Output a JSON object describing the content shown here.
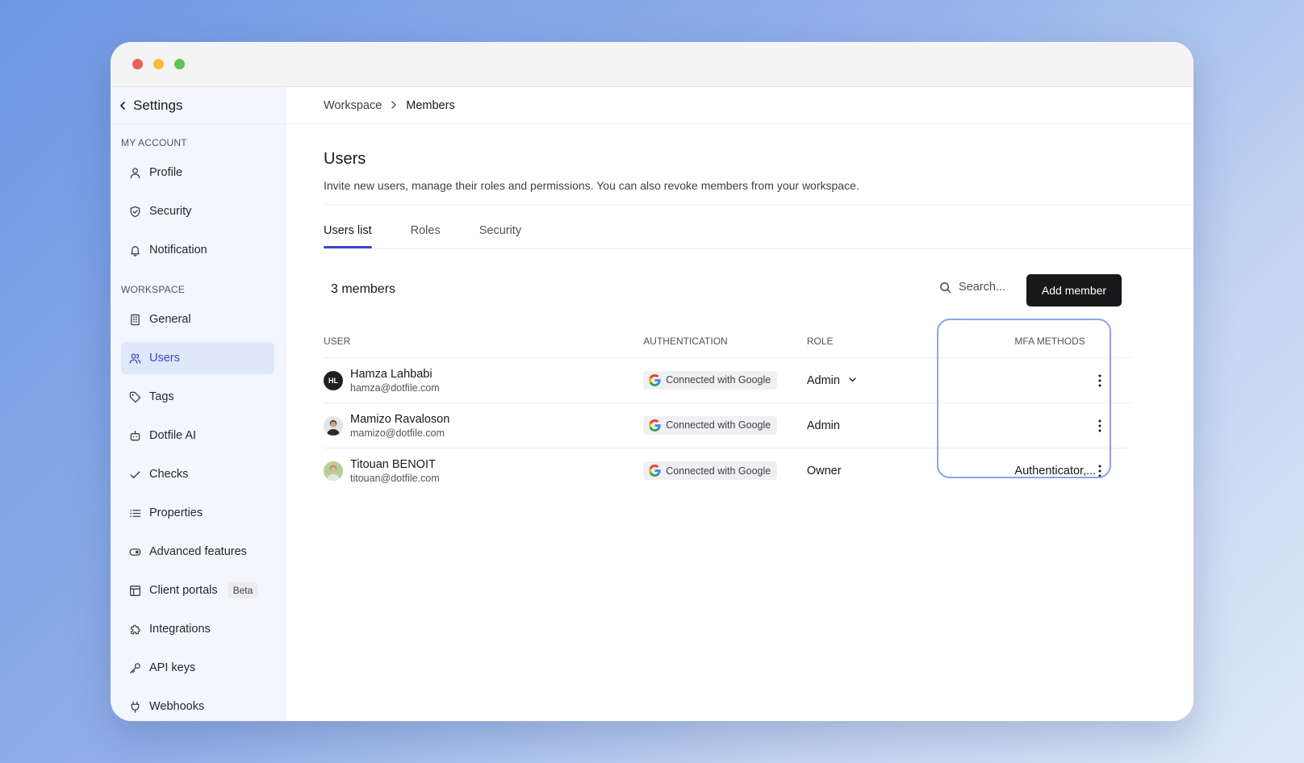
{
  "sidebar": {
    "title": "Settings",
    "sections": [
      {
        "heading": "My account",
        "items": [
          {
            "label": "Profile",
            "icon": "user-icon"
          },
          {
            "label": "Security",
            "icon": "shield-icon"
          },
          {
            "label": "Notification",
            "icon": "bell-icon"
          }
        ]
      },
      {
        "heading": "Workspace",
        "items": [
          {
            "label": "General",
            "icon": "building-icon"
          },
          {
            "label": "Users",
            "icon": "users-icon",
            "active": true
          },
          {
            "label": "Tags",
            "icon": "tag-icon"
          },
          {
            "label": "Dotfile AI",
            "icon": "robot-icon"
          },
          {
            "label": "Checks",
            "icon": "check-icon"
          },
          {
            "label": "Properties",
            "icon": "list-icon"
          },
          {
            "label": "Advanced features",
            "icon": "toggle-icon"
          },
          {
            "label": "Client portals",
            "icon": "layout-icon",
            "badge": "Beta"
          },
          {
            "label": "Integrations",
            "icon": "puzzle-icon"
          },
          {
            "label": "API keys",
            "icon": "key-icon"
          },
          {
            "label": "Webhooks",
            "icon": "webhook-icon"
          }
        ]
      }
    ]
  },
  "breadcrumb": {
    "parent": "Workspace",
    "current": "Members"
  },
  "page": {
    "title": "Users",
    "description": "Invite new users, manage their roles and permissions. You can also revoke members from your workspace."
  },
  "tabs": [
    {
      "label": "Users list",
      "active": true
    },
    {
      "label": "Roles"
    },
    {
      "label": "Security"
    }
  ],
  "members": {
    "count_label": "3 members",
    "search_placeholder": "Search...",
    "add_button": "Add member"
  },
  "table": {
    "headers": {
      "user": "User",
      "authentication": "Authentication",
      "role": "Role",
      "mfa": "MFA methods"
    },
    "rows": [
      {
        "name": "Hamza Lahbabi",
        "email": "hamza@dotfile.com",
        "initials": "HL",
        "auth": "Connected with Google",
        "role": "Admin",
        "role_dropdown": true,
        "mfa": ""
      },
      {
        "name": "Mamizo Ravaloson",
        "email": "mamizo@dotfile.com",
        "initials": "",
        "auth": "Connected with Google",
        "role": "Admin",
        "role_dropdown": false,
        "mfa": ""
      },
      {
        "name": "Titouan BENOIT",
        "email": "titouan@dotfile.com",
        "initials": "",
        "auth": "Connected with Google",
        "role": "Owner",
        "role_dropdown": false,
        "mfa": "Authenticator,..."
      }
    ]
  },
  "colors": {
    "accent": "#3949c8",
    "active_bg": "#dfe7fb",
    "button_bg": "#18181b",
    "highlight": "#8ea3ef"
  }
}
